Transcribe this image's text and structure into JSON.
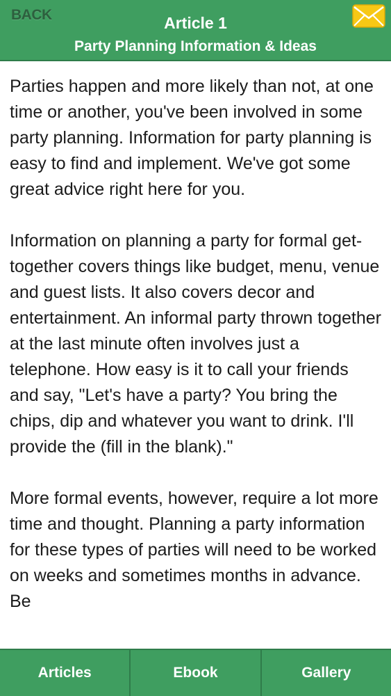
{
  "header": {
    "back_label": "BACK",
    "title": "Article 1",
    "subtitle": "Party Planning Information & Ideas",
    "mail_icon": "envelope-icon"
  },
  "article": {
    "paragraphs": [
      "Parties happen and more likely than not, at one time or another, you've been involved in some party planning. Information for party planning is easy to find and implement. We've got some great advice right here for you.",
      "Information on planning a party for formal get-together covers things like budget, menu, venue and guest lists. It also covers decor and entertainment. An informal party thrown together at the last minute often involves just a telephone. How easy is it to call your friends and say, \"Let's have a party? You bring the chips, dip and whatever you want to drink. I'll provide the (fill in the blank).\"",
      "More formal events, however, require a lot more time and thought. Planning a party information for these types of parties will need to be worked on weeks and sometimes months in advance. Be"
    ]
  },
  "tabbar": {
    "tabs": [
      {
        "label": "Articles"
      },
      {
        "label": "Ebook"
      },
      {
        "label": "Gallery"
      }
    ]
  },
  "colors": {
    "bar_green": "#3f9e60",
    "bar_border": "#2f7c4a",
    "back_text": "#2d5f3e",
    "mail_yellow": "#f7c815"
  }
}
